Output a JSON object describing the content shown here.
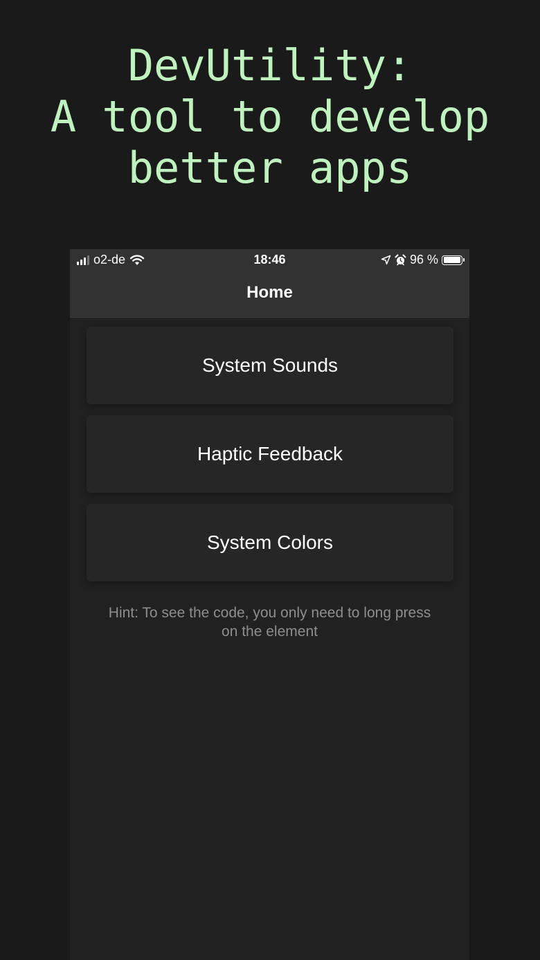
{
  "headline": {
    "line1": "DevUtility:",
    "line2": "A tool to develop",
    "line3": "better apps"
  },
  "status_bar": {
    "carrier": "o2-de",
    "time": "18:46",
    "battery_text": "96 %",
    "battery_level": 0.96,
    "icons": [
      "signal-icon",
      "wifi-icon",
      "location-icon",
      "alarm-icon",
      "battery-icon"
    ]
  },
  "nav": {
    "title": "Home"
  },
  "menu": {
    "items": [
      {
        "label": "System Sounds"
      },
      {
        "label": "Haptic Feedback"
      },
      {
        "label": "System Colors"
      }
    ]
  },
  "hint": {
    "line1": "Hint: To see the code, you only need to long press",
    "line2": "on the element"
  },
  "colors": {
    "background": "#1a1a1a",
    "headline": "#bff2be",
    "phone_background": "#212121",
    "bar_background": "#323232",
    "card_background": "#262626",
    "hint_text": "#8e8e8e"
  }
}
